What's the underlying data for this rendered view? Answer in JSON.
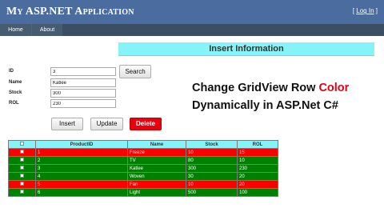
{
  "app": {
    "title": "My ASP.NET Application"
  },
  "login": {
    "open": "[",
    "link": "Log In",
    "close": "]"
  },
  "menu": {
    "items": [
      {
        "label": "Home"
      },
      {
        "label": "About"
      }
    ]
  },
  "form": {
    "heading": "Insert Information",
    "fields": [
      {
        "label": "ID",
        "value": "3"
      },
      {
        "label": "Name",
        "value": "Katlee"
      },
      {
        "label": "Stock",
        "value": "300"
      },
      {
        "label": "ROL",
        "value": "230"
      }
    ],
    "search_label": "Search",
    "insert_label": "Insert",
    "update_label": "Update",
    "delete_label": "Delete"
  },
  "promo": {
    "line1_a": "Change GridView Row ",
    "line1_b": "Color",
    "line2": "Dynamically in ASP.Net C#"
  },
  "grid": {
    "headers": [
      "",
      "ProductID",
      "Name",
      "Stock",
      "ROL"
    ],
    "rows": [
      {
        "id": "1",
        "name": "Freeze",
        "stock": "10",
        "rol": "15",
        "status": "red"
      },
      {
        "id": "2",
        "name": "TV",
        "stock": "80",
        "rol": "10",
        "status": "green"
      },
      {
        "id": "3",
        "name": "Katlee",
        "stock": "300",
        "rol": "230",
        "status": "green"
      },
      {
        "id": "4",
        "name": "Woven",
        "stock": "30",
        "rol": "20",
        "status": "green"
      },
      {
        "id": "5",
        "name": "Fan",
        "stock": "10",
        "rol": "20",
        "status": "red"
      },
      {
        "id": "6",
        "name": "Light",
        "stock": "500",
        "rol": "100",
        "status": "green"
      }
    ]
  },
  "colors": {
    "titlebar": "#4b6c9e",
    "menubar": "#3a4f63",
    "banner": "#85f3f7",
    "row_red": "#fc0000",
    "row_green": "#008000",
    "delete_button": "#e8000e",
    "promo_accent": "#e60012"
  }
}
